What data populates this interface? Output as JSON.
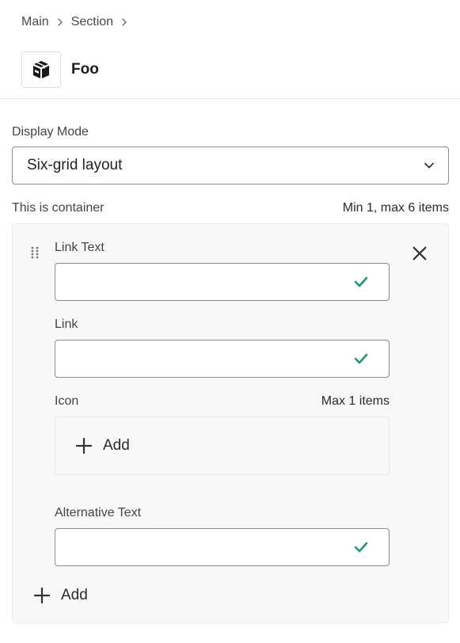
{
  "breadcrumb": {
    "items": [
      "Main",
      "Section"
    ]
  },
  "header": {
    "title": "Foo",
    "icon": "box-stack-icon"
  },
  "display_mode": {
    "label": "Display Mode",
    "value": "Six-grid layout"
  },
  "container": {
    "label": "This is container",
    "constraint": "Min 1, max 6 items",
    "item": {
      "link_text": {
        "label": "Link Text",
        "value": ""
      },
      "link": {
        "label": "Link",
        "value": ""
      },
      "icon": {
        "label": "Icon",
        "constraint": "Max 1 items",
        "add_label": "Add"
      },
      "alt_text": {
        "label": "Alternative Text",
        "value": ""
      }
    },
    "add_label": "Add"
  },
  "colors": {
    "check": "#1a9a6a",
    "border": "#8c8c8c",
    "panel": "#f8f8f8"
  }
}
